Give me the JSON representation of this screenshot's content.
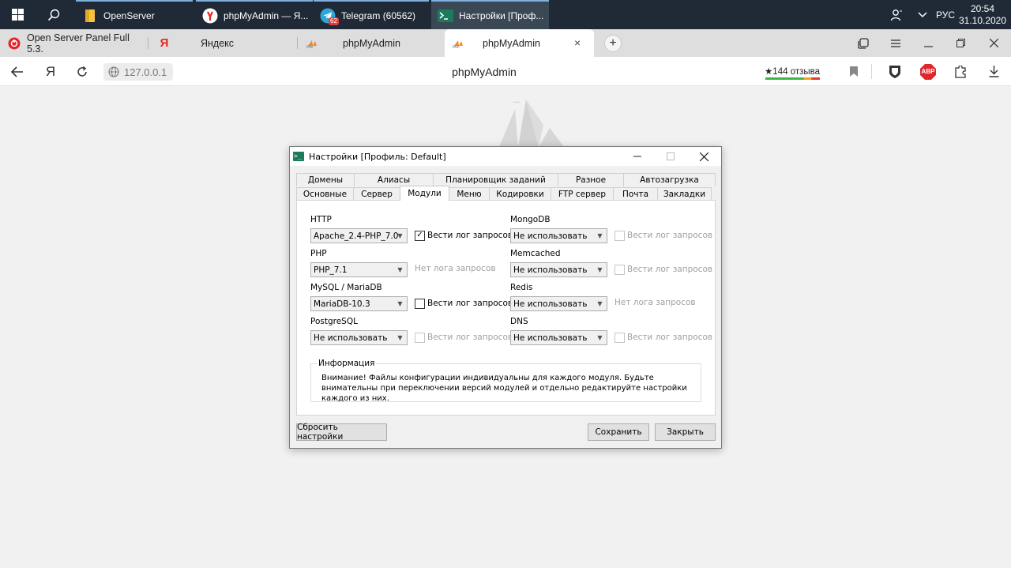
{
  "taskbar": {
    "apps": [
      {
        "label": "OpenServer",
        "icon": "folder-icon"
      },
      {
        "label": "phpMyAdmin — Я...",
        "icon": "yandex-browser-icon"
      },
      {
        "label": "Telegram (60562)",
        "icon": "telegram-icon",
        "badge": "62"
      },
      {
        "label": "Настройки [Проф...",
        "icon": "terminal-icon"
      }
    ],
    "language": "РУС",
    "time": "20:54",
    "date": "31.10.2020"
  },
  "browser": {
    "tabs": [
      {
        "label": "Open Server Panel Full 5.3.",
        "icon": "openserver-icon"
      },
      {
        "label": "Яндекс",
        "icon": "yandex-icon"
      },
      {
        "label": "phpMyAdmin",
        "icon": "pma-icon"
      },
      {
        "label": "phpMyAdmin",
        "icon": "pma-icon",
        "active": true
      }
    ],
    "url": "127.0.0.1",
    "page_title": "phpMyAdmin",
    "reviews": "★144 отзыва",
    "yandex_letter": "Я",
    "abp_label": "ABP"
  },
  "dialog": {
    "title": "Настройки [Профиль: Default]",
    "tabs_top": [
      "Домены",
      "Алиасы",
      "Планировщик заданий",
      "Разное",
      "Автозагрузка"
    ],
    "tabs_bottom": [
      "Основные",
      "Сервер",
      "Модули",
      "Меню",
      "Кодировки",
      "FTP сервер",
      "Почта",
      "Закладки"
    ],
    "selected_tab": "Модули",
    "modules_left": [
      {
        "label": "HTTP",
        "value": "Apache_2.4-PHP_7.0-",
        "log": "Вести лог запросов",
        "log_type": "checkbox",
        "checked": true,
        "enabled": true
      },
      {
        "label": "PHP",
        "value": "PHP_7.1",
        "log": "Нет лога запросов",
        "log_type": "text"
      },
      {
        "label": "MySQL / MariaDB",
        "value": "MariaDB-10.3",
        "log": "Вести лог запросов",
        "log_type": "checkbox",
        "checked": false,
        "enabled": true
      },
      {
        "label": "PostgreSQL",
        "value": "Не использовать",
        "log": "Вести лог запросов",
        "log_type": "checkbox",
        "checked": false,
        "enabled": false
      }
    ],
    "modules_right": [
      {
        "label": "MongoDB",
        "value": "Не использовать",
        "log": "Вести лог запросов",
        "log_type": "checkbox",
        "checked": false,
        "enabled": false
      },
      {
        "label": "Memcached",
        "value": "Не использовать",
        "log": "Вести лог запросов",
        "log_type": "checkbox",
        "checked": false,
        "enabled": false
      },
      {
        "label": "Redis",
        "value": "Не использовать",
        "log": "Нет лога запросов",
        "log_type": "text"
      },
      {
        "label": "DNS",
        "value": "Не использовать",
        "log": "Вести лог запросов",
        "log_type": "checkbox",
        "checked": false,
        "enabled": false
      }
    ],
    "info_title": "Информация",
    "info_text": "Внимание! Файлы конфигурации индивидуальны для каждого модуля. Будьте внимательны при переключении версий модулей и отдельно редактируйте настройки каждого из них.",
    "buttons": {
      "reset": "Сбросить настройки",
      "save": "Сохранить",
      "close": "Закрыть"
    }
  }
}
